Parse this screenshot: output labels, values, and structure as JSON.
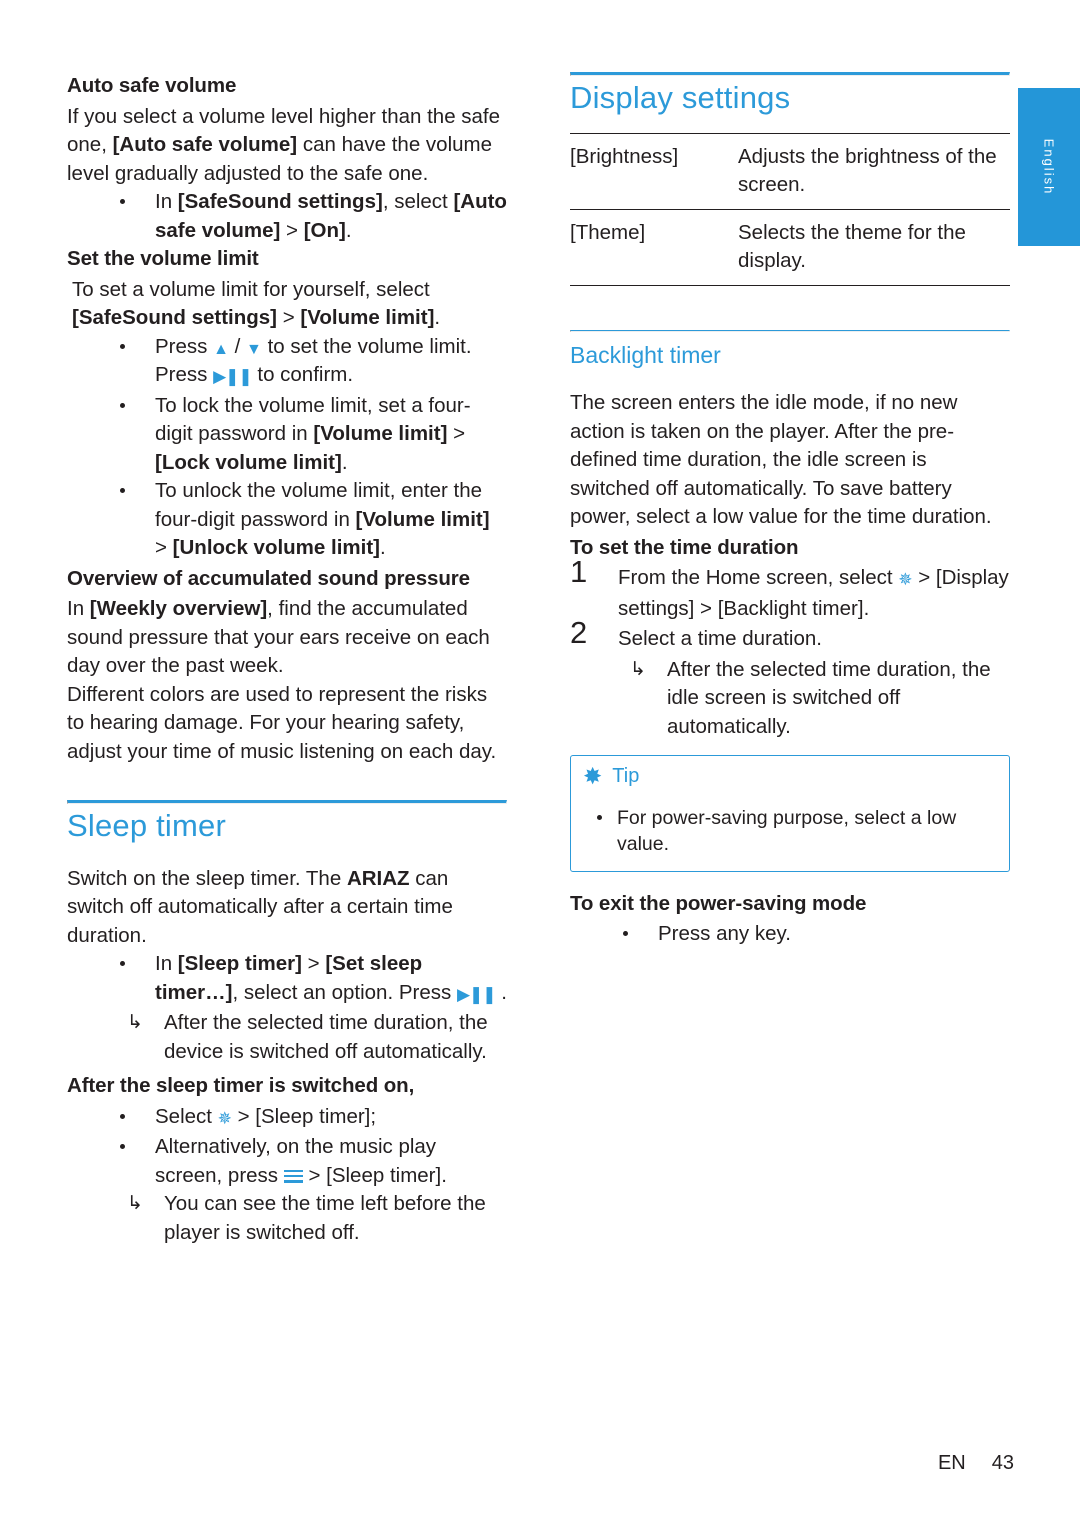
{
  "side_tab": {
    "language": "English"
  },
  "left_column": {
    "heading_auto_safe_volume": "Auto safe volume",
    "para_auto_safe_volume_1": "If you select a volume level higher than the safe one, ",
    "para_auto_safe_volume_bold": "[Auto safe volume]",
    "para_auto_safe_volume_2": " can have the volume level gradually adjusted to the safe one.",
    "bullet_auto_safe_1_pre": "In ",
    "bullet_auto_safe_1_b1": "[SafeSound settings]",
    "bullet_auto_safe_1_mid": ", select ",
    "bullet_auto_safe_1_b2": "[Auto safe volume]",
    "bullet_auto_safe_1_gt": " > ",
    "bullet_auto_safe_1_b3": "[On]",
    "bullet_auto_safe_1_end": ".",
    "heading_set_volume_limit": "Set the volume limit",
    "para_set_volume_limit": "To set a volume limit for yourself, select ",
    "para_set_volume_limit_b1": "[SafeSound settings]",
    "para_set_volume_limit_gt": " > ",
    "para_set_volume_limit_b2": "[Volume limit]",
    "para_set_volume_limit_end": ".",
    "bullet_press_1": "Press ",
    "bullet_press_2": " / ",
    "bullet_press_3": " to set the volume limit. Press ",
    "bullet_press_4": " to confirm.",
    "bullet_lock_1": "To lock the volume limit, set a four-digit password in ",
    "bullet_lock_b1": "[Volume limit]",
    "bullet_lock_gt": " > ",
    "bullet_lock_b2": "[Lock volume limit]",
    "bullet_lock_end": ".",
    "bullet_unlock_1": "To unlock the volume limit, enter the four-digit password in ",
    "bullet_unlock_b1": "[Volume limit]",
    "bullet_unlock_gt": " > ",
    "bullet_unlock_b2": "[Unlock volume limit]",
    "bullet_unlock_end": ".",
    "heading_overview": "Overview of accumulated sound pressure",
    "para_overview_pre": "In ",
    "para_overview_b": "[Weekly overview]",
    "para_overview_post": ", find the accumulated sound pressure that your ears receive on each day over the past week.",
    "para_colors": "Different colors are used to represent the risks to hearing damage. For your hearing safety, adjust your time of music listening on each day.",
    "title_sleep_timer": "Sleep timer",
    "para_sleep_1": "Switch on the sleep timer. The ",
    "para_sleep_brand": "ARIAZ",
    "para_sleep_2": " can switch off automatically after a certain time duration.",
    "bullet_sleep_pre": "In ",
    "bullet_sleep_b1": "[Sleep timer]",
    "bullet_sleep_gt": " > ",
    "bullet_sleep_b2": "[Set sleep timer…]",
    "bullet_sleep_post": ", select an option. Press ",
    "bullet_sleep_end": " .",
    "arrow_sleep": "After the selected time duration, the device is switched off automatically.",
    "heading_after_sleep": "After the sleep timer is switched on,",
    "bullet_after_1_pre": "Select ",
    "bullet_after_1_gt": " > ",
    "bullet_after_1_b": "[Sleep timer]",
    "bullet_after_1_end": ";",
    "bullet_after_2_pre": "Alternatively, on the music play screen, press ",
    "bullet_after_2_gt": " > ",
    "bullet_after_2_b": "[Sleep timer]",
    "bullet_after_2_end": ".",
    "arrow_after": "You can see the time left before the player is switched off."
  },
  "right_column": {
    "title_display_settings": "Display settings",
    "settings_table": [
      {
        "key": "[Brightness]",
        "value": "Adjusts the brightness of the screen."
      },
      {
        "key": "[Theme]",
        "value": "Selects the theme for the display."
      }
    ],
    "subtitle_backlight_timer": "Backlight timer",
    "para_backlight": "The screen enters the idle mode, if no new action is taken on the player. After the pre-defined time duration, the idle screen is switched off automatically. To save battery power, select a low value for the time duration.",
    "heading_set_time_duration": "To set the time duration",
    "step1_pre": "From the Home screen, select ",
    "step1_gt": " > ",
    "step1_b1": "[Display settings]",
    "step1_gt2": " > ",
    "step1_b2": "[Backlight timer]",
    "step1_end": ".",
    "step2": "Select a time duration.",
    "step2_arrow": "After the selected time duration, the idle screen is switched off automatically.",
    "tip_label": "Tip",
    "tip_text": "For power-saving purpose, select a low value.",
    "heading_exit_power_saving": "To exit the power-saving mode",
    "bullet_press_any_key": "Press any key."
  },
  "footer": {
    "lang_code": "EN",
    "page_number": "43"
  },
  "colors": {
    "accent": "#2c9ad9",
    "tab": "#2496d8",
    "text": "#231f20"
  }
}
